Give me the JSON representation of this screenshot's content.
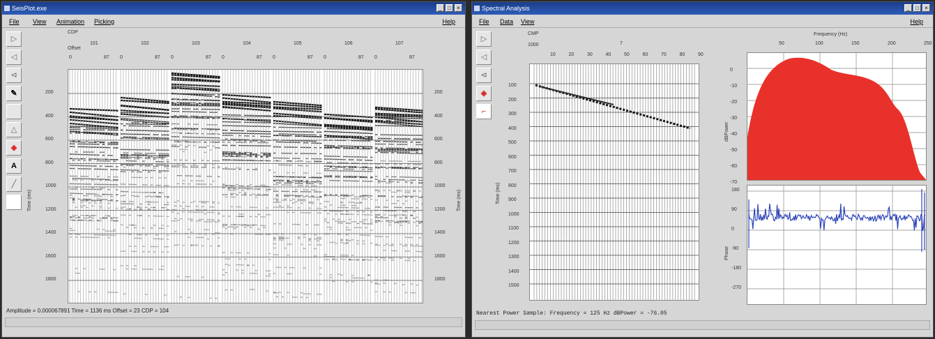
{
  "left_window": {
    "title": "SeisPlot.exe",
    "buttons": [
      "_",
      "□",
      "×"
    ],
    "menu": [
      "File",
      "View",
      "Animation",
      "Picking"
    ],
    "help": "Help",
    "header_rows": [
      "CDP",
      "Offset"
    ],
    "cdp_labels": [
      "101",
      "102",
      "103",
      "104",
      "105",
      "106",
      "107"
    ],
    "offset_labels": [
      "0",
      "87",
      "0",
      "87",
      "0",
      "87",
      "0",
      "87",
      "0",
      "87",
      "0",
      "87",
      "0",
      "87"
    ],
    "time_ticks": [
      "200",
      "400",
      "600",
      "800",
      "1000",
      "1200",
      "1400",
      "1600",
      "1800"
    ],
    "y_label": "Time (ms)",
    "status": "Amplitude = 0.000067891  Time = 1136 ms  Offset = 23  CDP = 104"
  },
  "right_window": {
    "title": "Spectral Analysis",
    "buttons": [
      "_",
      "□",
      "×"
    ],
    "menu": [
      "File",
      "Data",
      "View"
    ],
    "help": "Help",
    "gather_header": [
      "CMP",
      "1000",
      "7"
    ],
    "gather_top_ticks": [
      "10",
      "20",
      "30",
      "40",
      "50",
      "60",
      "70",
      "80",
      "90"
    ],
    "gather_time_ticks": [
      "100",
      "200",
      "300",
      "400",
      "500",
      "600",
      "700",
      "800",
      "900",
      "1000",
      "1100",
      "1200",
      "1300",
      "1400",
      "1500"
    ],
    "gather_y_label": "Time (ms)",
    "spectrum_title": "Frequency (Hz)",
    "spectrum_freq_ticks": [
      "50",
      "100",
      "150",
      "200",
      "250"
    ],
    "amp_ticks": [
      "0",
      "-10",
      "-20",
      "-30",
      "-40",
      "-50",
      "-60",
      "-70"
    ],
    "amp_label": "dBPower",
    "phase_ticks": [
      "180",
      "90",
      "0",
      "-90",
      "-180",
      "-270"
    ],
    "phase_label": "Phase",
    "status": "Nearest Power Sample:  Frequency =   125 Hz   dBPower =   -76.05",
    "spectrum_color": "#e8312a",
    "phase_color": "#2c43b8"
  }
}
